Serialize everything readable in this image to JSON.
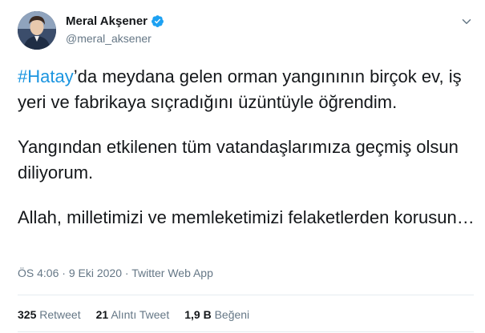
{
  "author": {
    "display_name": "Meral Akşener",
    "handle": "@meral_aksener",
    "verified_icon": "verified-badge-icon",
    "colors": {
      "verified": "#1da1f2"
    }
  },
  "menu": {
    "icon": "chevron-down-icon"
  },
  "tweet": {
    "hashtag": "#Hatay",
    "para1_rest": "’da meydana gelen orman yangınının birçok ev, iş yeri ve fabrikaya sıçradığını üzüntüyle öğrendim.",
    "para2": "Yangından etkilenen tüm vatandaşlarımıza geçmiş olsun diliyorum.",
    "para3": "Allah, milletimizi ve memleketimizi felaketlerden korusun…"
  },
  "meta": {
    "time": "ÖS 4:06",
    "separator": "·",
    "date": "9 Eki 2020",
    "source": "Twitter Web App"
  },
  "stats": {
    "retweets": {
      "count": "325",
      "label": "Retweet"
    },
    "quotes": {
      "count": "21",
      "label": "Alıntı Tweet"
    },
    "likes": {
      "count": "1,9 B",
      "label": "Beğeni"
    }
  },
  "colors": {
    "link": "#1b95e0",
    "muted": "#657786",
    "text": "#14171a",
    "divider": "#e6ecf0"
  }
}
